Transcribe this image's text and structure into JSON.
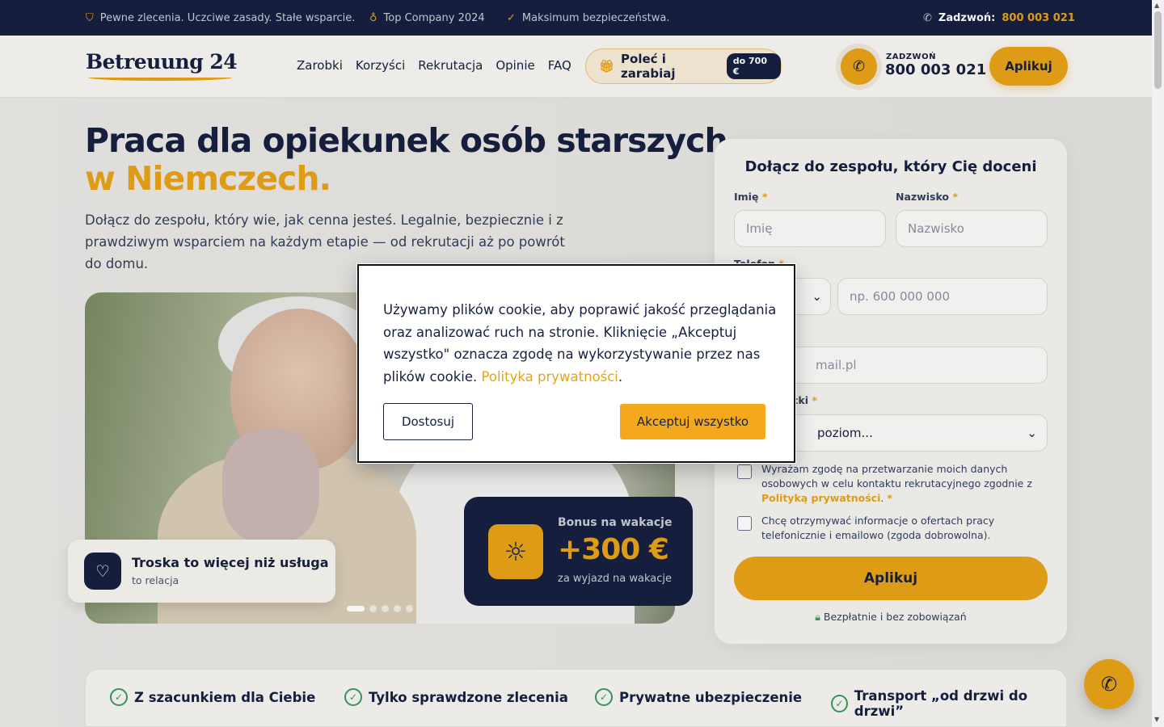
{
  "topbar": {
    "item1": "Pewne zlecenia. Uczciwe zasady. Stałe wsparcie.",
    "item2": "Top Company 2024",
    "item3": "Maksimum bezpieczeństwa.",
    "phone_label": "Zadzwoń:",
    "phone_number": "800 003 021"
  },
  "header": {
    "logo": "Betreuung 24",
    "nav": [
      "Zarobki",
      "Korzyści",
      "Rekrutacja",
      "Opinie",
      "FAQ"
    ],
    "refer_label": "Poleć i zarabiaj",
    "refer_badge": "do 700 €",
    "call_label": "ZADZWOŃ",
    "call_number": "800 003 021",
    "apply_label": "Aplikuj"
  },
  "hero": {
    "title_line1": "Praca dla opiekunek osób starszych",
    "title_line2": "w Niemczech.",
    "lead": "Dołącz do zespołu, który wie, jak cenna jesteś. Legalnie, bezpiecznie i z prawdziwym wsparciem na każdym etapie — od rekrutacji aż po powrót do domu.",
    "care_title": "Troska to więcej niż usługa",
    "care_sub": "to relacja",
    "bonus_title": "Bonus na wakacje",
    "bonus_value": "+300 €",
    "bonus_sub": "za wyjazd na wakacje",
    "slider_active_index": 1,
    "slider_total": 5
  },
  "form": {
    "title": "Dołącz do zespołu, który Cię doceni",
    "first_name_label": "Imię",
    "first_name_placeholder": "Imię",
    "last_name_label": "Nazwisko",
    "last_name_placeholder": "Nazwisko",
    "phone_label": "Telefon",
    "phone_placeholder": "np. 600 000 000",
    "email_placeholder": "mail.pl",
    "language_label": "cki",
    "language_placeholder": "poziom...",
    "consent1_text": "Wyrażam zgodę na przetwarzanie moich danych osobowych w celu kontaktu rekrutacyjnego zgodnie z",
    "consent1_link": "Polityką prywatności",
    "consent2_text": "Chcę otrzymywać informacje o ofertach pracy telefonicznie i emailowo (zgoda dobrowolna).",
    "submit_label": "Aplikuj",
    "free_note": "Bezpłatnie i bez zobowiązań"
  },
  "features": [
    "Z szacunkiem dla Ciebie",
    "Tylko sprawdzone zlecenia",
    "Prywatne ubezpieczenie",
    "Transport „od drzwi do drzwi”"
  ],
  "cookie": {
    "text": "Używamy plików cookie, aby poprawić jakość przeglądania oraz analizować ruch na stronie. Kliknięcie „Akceptuj wszystko\" oznacza zgodę na wykorzystywanie przez nas plików cookie.",
    "link": "Polityka prywatności",
    "customize_label": "Dostosuj",
    "accept_label": "Akceptuj wszystko"
  },
  "colors": {
    "accent": "#e8a317",
    "navy": "#16203f",
    "success": "#3a9a5b"
  },
  "icons": [
    "shield-icon",
    "award-icon",
    "check-icon",
    "phone-icon",
    "gift-icon",
    "heart-icon",
    "sun-icon",
    "lock-icon",
    "check-circle-icon"
  ]
}
